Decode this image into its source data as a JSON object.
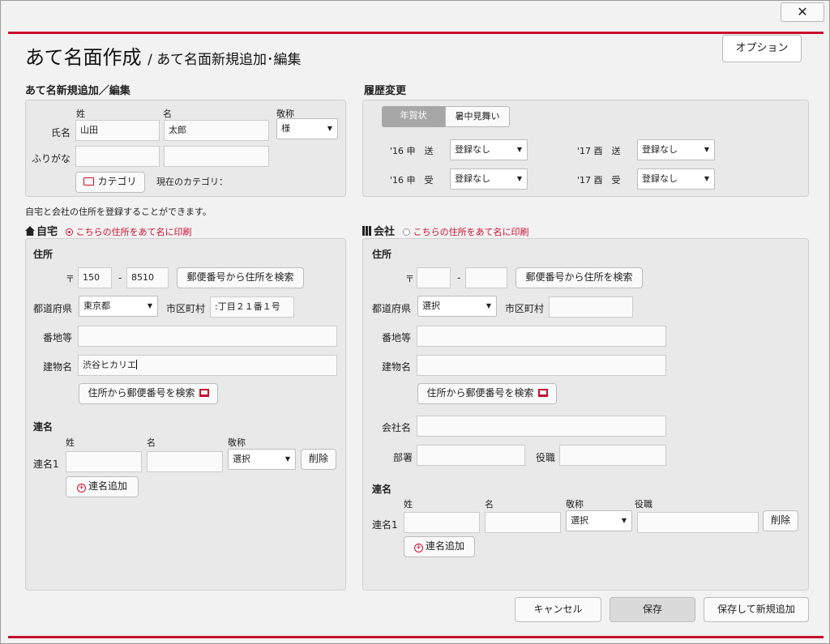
{
  "window": {
    "close_glyph": "✕"
  },
  "header": {
    "title": "あて名面作成",
    "subtitle": "/ あて名面新規追加･編集",
    "option_button": "オプション"
  },
  "name_section": {
    "heading": "あて名新規追加／編集",
    "col_last": "姓",
    "col_first": "名",
    "col_honorific": "敬称",
    "name_label": "氏名",
    "last_name": "山田",
    "first_name": "太郎",
    "honorific": "様",
    "kana_label": "ふりがな",
    "last_kana": "",
    "first_kana": "",
    "category_button": "カテゴリ",
    "current_category_label": "現在のカテゴリ："
  },
  "history": {
    "heading": "履歴変更",
    "tabs": [
      {
        "label": "年賀状",
        "active": true
      },
      {
        "label": "暑中見舞い",
        "active": false
      }
    ],
    "rows": [
      {
        "label": "'16 申　送",
        "value": "登録なし"
      },
      {
        "label": "'17 酉　送",
        "value": "登録なし"
      },
      {
        "label": "'16 申　受",
        "value": "登録なし"
      },
      {
        "label": "'17 酉　受",
        "value": "登録なし"
      }
    ]
  },
  "note": "自宅と会社の住所を登録することができます。",
  "home": {
    "heading": "自宅",
    "print_option": "こちらの住所をあて名に印刷",
    "selected": true,
    "address_heading": "住所",
    "postal_mark": "〒",
    "postal_dash": "-",
    "postal1": "150",
    "postal2": "8510",
    "postal_search_button": "郵便番号から住所を検索",
    "prefecture_label": "都道府県",
    "prefecture": "東京都",
    "city_label": "市区町村",
    "city": ":丁目２１番１号",
    "street_label": "番地等",
    "street": "",
    "building_label": "建物名",
    "building": "渋谷ヒカリエ",
    "address_search_button": "住所から郵便番号を検索",
    "joint_heading": "連名",
    "joint_col_last": "姓",
    "joint_col_first": "名",
    "joint_col_honorific": "敬称",
    "joint_label": "連名1",
    "joint_last": "",
    "joint_first": "",
    "joint_honorific": "選択",
    "delete_button": "削除",
    "add_joint_button": "連名追加"
  },
  "company": {
    "heading": "会社",
    "print_option": "こちらの住所をあて名に印刷",
    "selected": false,
    "address_heading": "住所",
    "postal_mark": "〒",
    "postal_dash": "-",
    "postal1": "",
    "postal2": "",
    "postal_search_button": "郵便番号から住所を検索",
    "prefecture_label": "都道府県",
    "prefecture": "選択",
    "city_label": "市区町村",
    "city": "",
    "street_label": "番地等",
    "street": "",
    "building_label": "建物名",
    "building": "",
    "address_search_button": "住所から郵便番号を検索",
    "company_label": "会社名",
    "company_name": "",
    "department_label": "部署",
    "department": "",
    "position_label": "役職",
    "position": "",
    "joint_heading": "連名",
    "joint_col_last": "姓",
    "joint_col_first": "名",
    "joint_col_honorific": "敬称",
    "joint_col_position": "役職",
    "joint_label": "連名1",
    "joint_last": "",
    "joint_first": "",
    "joint_honorific": "選択",
    "joint_position": "",
    "delete_button": "削除",
    "add_joint_button": "連名追加"
  },
  "footer": {
    "cancel_button": "キャンセル",
    "save_button": "保存",
    "save_new_button": "保存して新規追加"
  },
  "colors": {
    "accent": "#c8102e",
    "panel": "#e9e9e9"
  }
}
